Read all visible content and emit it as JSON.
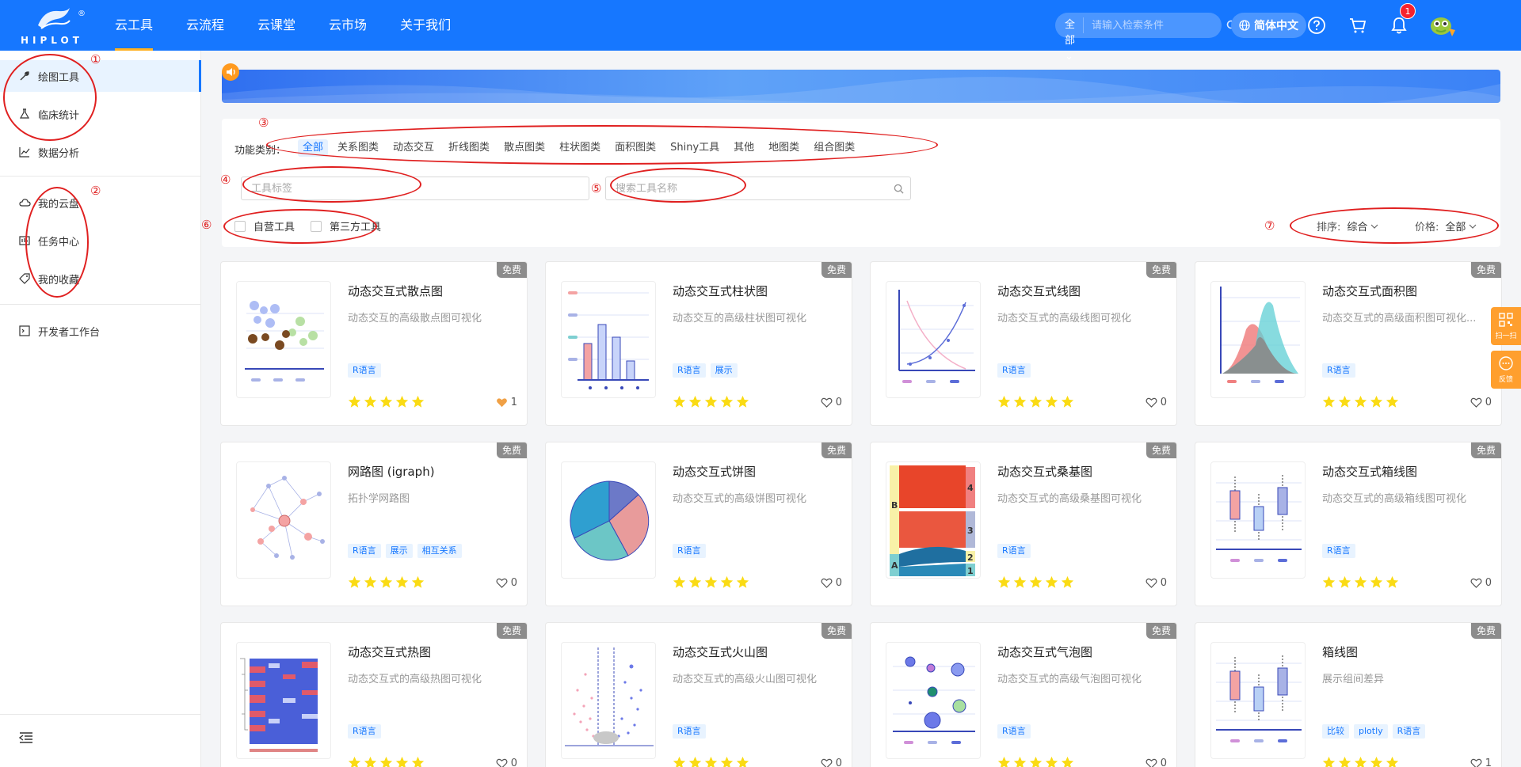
{
  "brand": {
    "logo_text": "HIPLOT",
    "reg": "®"
  },
  "nav": [
    {
      "label": "云工具"
    },
    {
      "label": "云流程"
    },
    {
      "label": "云课堂"
    },
    {
      "label": "云市场"
    },
    {
      "label": "关于我们"
    }
  ],
  "search": {
    "scope": "全部",
    "placeholder": "请输入检索条件"
  },
  "lang": "简体中文",
  "notifications": {
    "count": "1"
  },
  "sidebar": {
    "items": [
      {
        "label": "绘图工具"
      },
      {
        "label": "临床统计"
      },
      {
        "label": "数据分析"
      },
      {
        "label": "我的云盘"
      },
      {
        "label": "任务中心"
      },
      {
        "label": "我的收藏"
      },
      {
        "label": "开发者工作台"
      }
    ]
  },
  "filter": {
    "category_label": "功能类别：",
    "categories": [
      "全部",
      "关系图类",
      "动态交互",
      "折线图类",
      "散点图类",
      "柱状图类",
      "面积图类",
      "Shiny工具",
      "其他",
      "地图类",
      "组合图类"
    ],
    "tag_placeholder": "工具标签",
    "name_placeholder": "搜索工具名称",
    "checks": [
      "自营工具",
      "第三方工具"
    ],
    "sort_label": "排序:",
    "sort_value": "综合",
    "price_label": "价格:",
    "price_value": "全部"
  },
  "annotations": [
    "①",
    "②",
    "③",
    "④",
    "⑤",
    "⑥",
    "⑦"
  ],
  "free_label": "免费",
  "cards": [
    {
      "title": "动态交互式散点图",
      "desc": "动态交互的高级散点图可视化",
      "tags": [
        "R语言"
      ],
      "likes": "1",
      "liked": true
    },
    {
      "title": "动态交互式柱状图",
      "desc": "动态交互的高级柱状图可视化",
      "tags": [
        "R语言",
        "展示"
      ],
      "likes": "0"
    },
    {
      "title": "动态交互式线图",
      "desc": "动态交互式的高级线图可视化",
      "tags": [
        "R语言"
      ],
      "likes": "0"
    },
    {
      "title": "动态交互式面积图",
      "desc": "动态交互式的高级面积图可视化...",
      "tags": [
        "R语言"
      ],
      "likes": "0"
    },
    {
      "title": "网路图 (igraph)",
      "desc": "拓扑学网路图",
      "tags": [
        "R语言",
        "展示",
        "相互关系"
      ],
      "likes": "0"
    },
    {
      "title": "动态交互式饼图",
      "desc": "动态交互式的高级饼图可视化",
      "tags": [
        "R语言"
      ],
      "likes": "0"
    },
    {
      "title": "动态交互式桑基图",
      "desc": "动态交互式的高级桑基图可视化",
      "tags": [
        "R语言"
      ],
      "likes": "0"
    },
    {
      "title": "动态交互式箱线图",
      "desc": "动态交互式的高级箱线图可视化",
      "tags": [
        "R语言"
      ],
      "likes": "0"
    },
    {
      "title": "动态交互式热图",
      "desc": "动态交互式的高级热图可视化",
      "tags": [
        "R语言"
      ],
      "likes": "0"
    },
    {
      "title": "动态交互式火山图",
      "desc": "动态交互式的高级火山图可视化",
      "tags": [
        "R语言"
      ],
      "likes": "0"
    },
    {
      "title": "动态交互式气泡图",
      "desc": "动态交互式的高级气泡图可视化",
      "tags": [
        "R语言"
      ],
      "likes": "0"
    },
    {
      "title": "箱线图",
      "desc": "展示组间差异",
      "tags": [
        "比较",
        "plotly",
        "R语言"
      ],
      "likes": "1"
    }
  ],
  "float": {
    "qr": "扫一扫",
    "feedback": "反馈"
  },
  "sankey_labels": [
    "B",
    "A",
    "4",
    "3",
    "2",
    "1"
  ]
}
